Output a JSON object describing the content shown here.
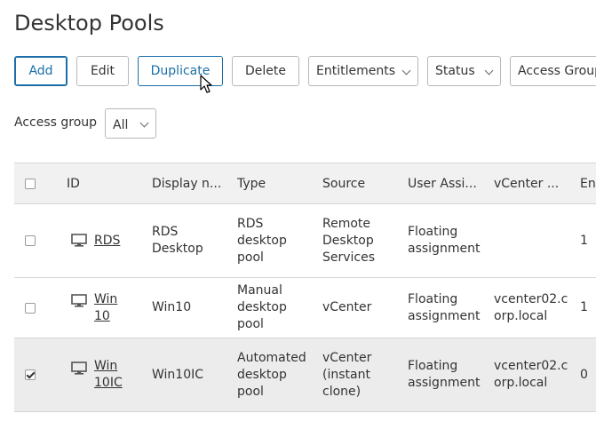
{
  "page": {
    "title": "Desktop Pools"
  },
  "toolbar": {
    "add": "Add",
    "edit": "Edit",
    "duplicate": "Duplicate",
    "delete": "Delete",
    "entitlements": "Entitlements",
    "status": "Status",
    "access_group": "Access Group"
  },
  "filter": {
    "label": "Access group",
    "value": "All"
  },
  "table": {
    "headers": [
      "ID",
      "Display n...",
      "Type",
      "Source",
      "User Assi...",
      "vCenter ...",
      "Ent"
    ],
    "rows": [
      {
        "id": "RDS",
        "display": "RDS Desktop",
        "type": "RDS desktop pool",
        "source": "Remote Desktop Services",
        "assignment": "Floating assignment",
        "vcenter": "",
        "ent": "1",
        "checked": false
      },
      {
        "id": "Win10",
        "display": "Win10",
        "type": "Manual desktop pool",
        "source": "vCenter",
        "assignment": "Floating assignment",
        "vcenter": "vcenter02.corp.local",
        "ent": "1",
        "checked": false
      },
      {
        "id": "Win10IC",
        "display": "Win10IC",
        "type": "Automated desktop pool",
        "source": "vCenter (instant clone)",
        "assignment": "Floating assignment",
        "vcenter": "vcenter02.corp.local",
        "ent": "0",
        "checked": true
      }
    ]
  },
  "colors": {
    "accent": "#1b6fa8",
    "selected_row": "#ececec",
    "header_bg": "#f1f1f1"
  }
}
